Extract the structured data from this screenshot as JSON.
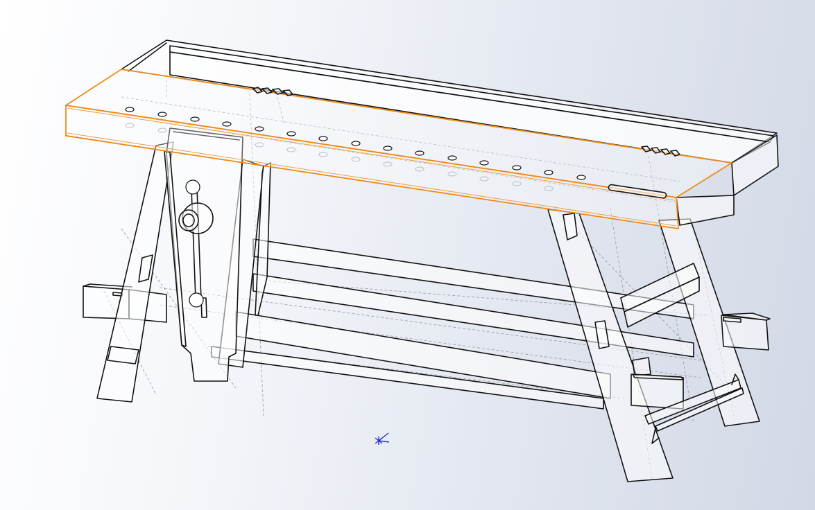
{
  "viewport": {
    "model": "workbench",
    "selected_feature": "benchtop-front-face",
    "highlight_color": "#ee8a16",
    "edge_color": "#111111",
    "hidden_edge_color": "#9aa0aa",
    "background_gradient": [
      "#ffffff",
      "#d2d8e6"
    ],
    "triad_color": "#2233cc"
  }
}
